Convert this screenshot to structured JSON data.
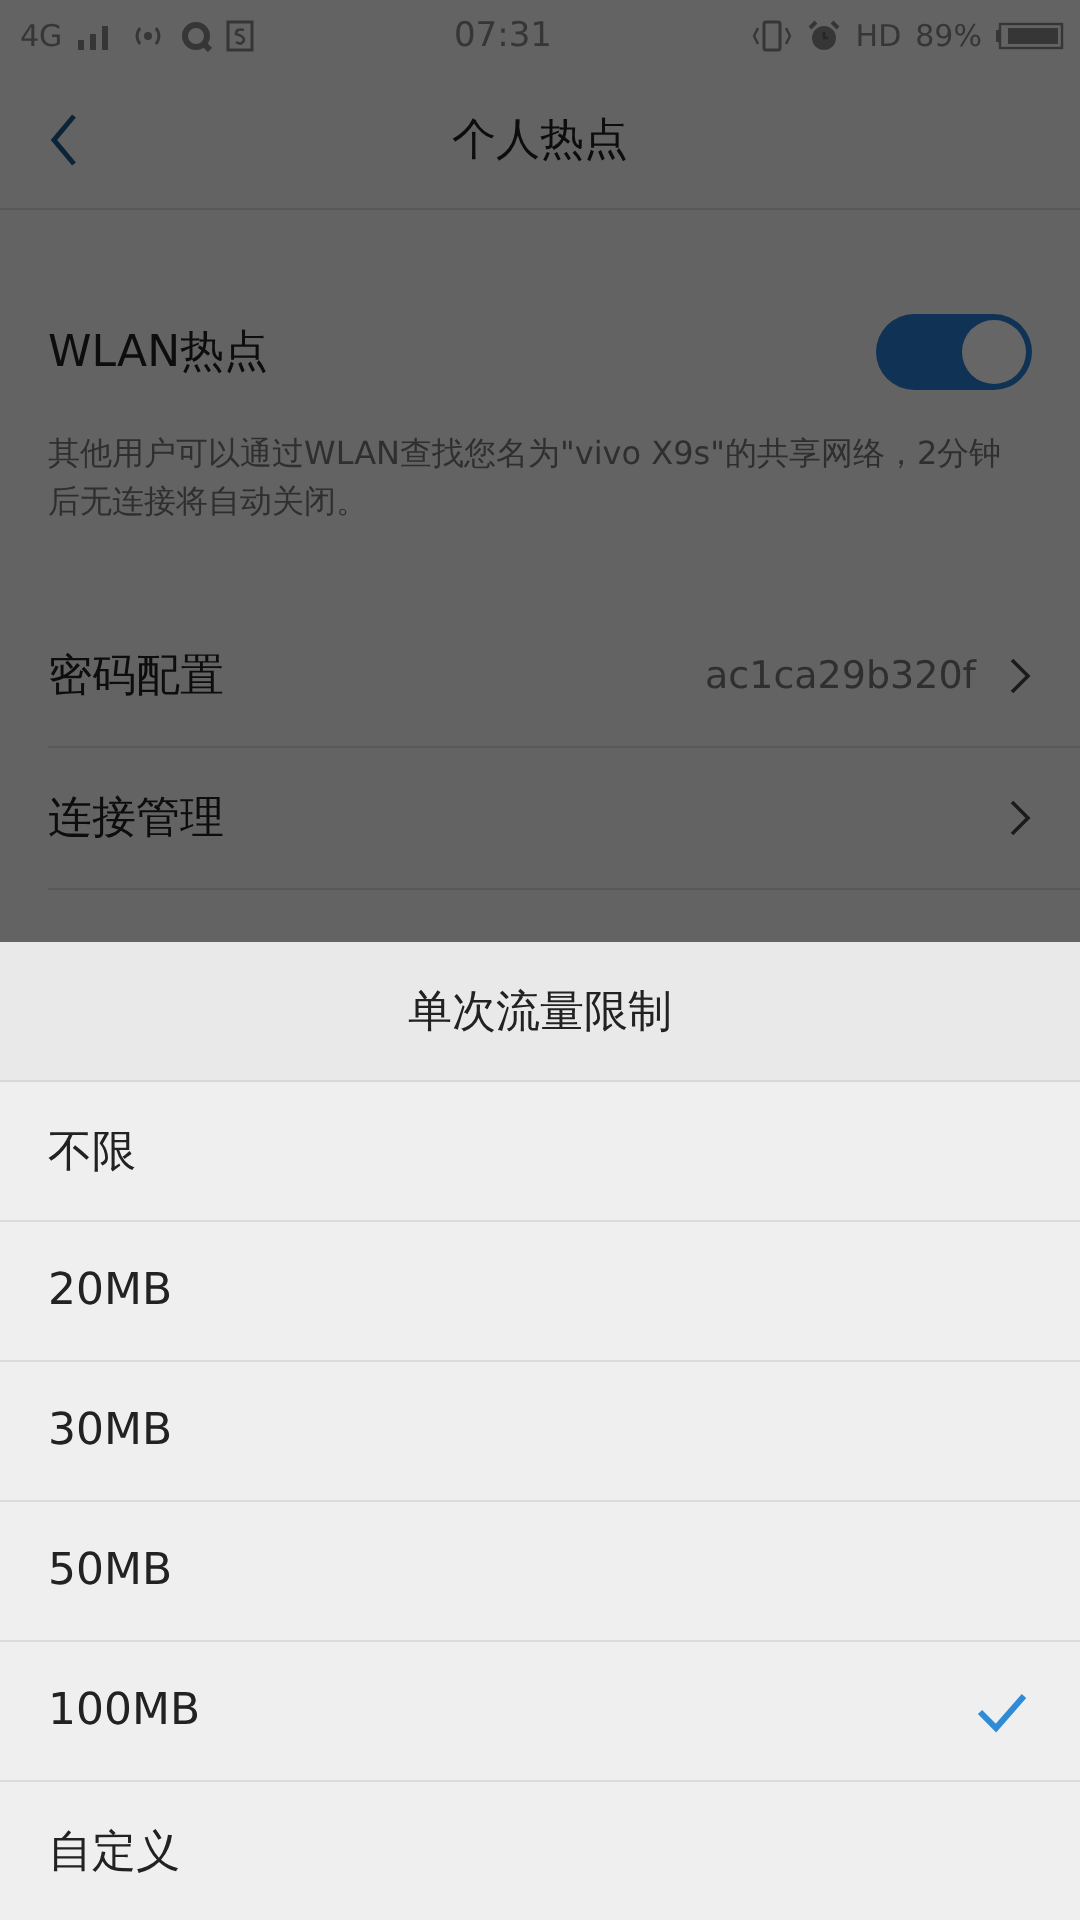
{
  "status_bar": {
    "network": "4G",
    "time": "07:31",
    "hd": "HD",
    "battery": "89%"
  },
  "header": {
    "title": "个人热点"
  },
  "hotspot": {
    "label": "WLAN热点",
    "on": true,
    "description": "其他用户可以通过WLAN查找您名为\"vivo X9s\"的共享网络，2分钟后无连接将自动关闭。"
  },
  "settings": [
    {
      "label": "密码配置",
      "value": "ac1ca29b320f"
    },
    {
      "label": "连接管理"
    }
  ],
  "sheet": {
    "title": "单次流量限制",
    "options": [
      {
        "label": "不限",
        "selected": false
      },
      {
        "label": "20MB",
        "selected": false
      },
      {
        "label": "30MB",
        "selected": false
      },
      {
        "label": "50MB",
        "selected": false
      },
      {
        "label": "100MB",
        "selected": true
      },
      {
        "label": "自定义",
        "selected": false
      }
    ]
  }
}
